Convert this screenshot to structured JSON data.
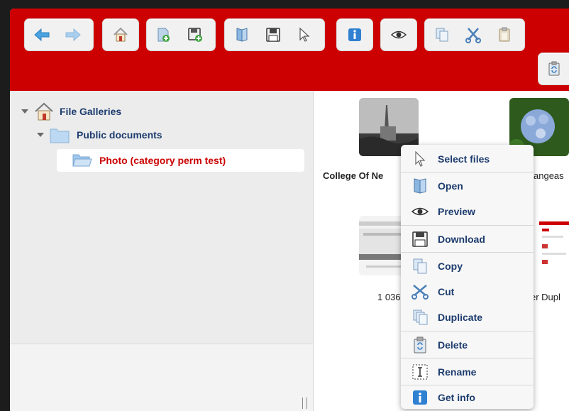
{
  "toolbar": {
    "buttons": [
      "back-icon",
      "forward-icon",
      "home-icon",
      "new-folder-icon",
      "save-new-icon",
      "open-icon",
      "download-icon",
      "select-icon",
      "info-icon",
      "preview-icon",
      "copy-icon",
      "cut-icon",
      "paste-icon",
      "refresh-icon"
    ]
  },
  "tree": {
    "root": "File Galleries",
    "child": "Public documents",
    "selected": "Photo (category perm test)"
  },
  "files": {
    "f1": "College Of Ne",
    "f2": "angeas",
    "f3": "1 036",
    "f4": "er Dupl"
  },
  "menu": {
    "select": "Select files",
    "open": "Open",
    "preview": "Preview",
    "download": "Download",
    "copy": "Copy",
    "cut": "Cut",
    "duplicate": "Duplicate",
    "delete": "Delete",
    "rename": "Rename",
    "info": "Get info"
  },
  "colors": {
    "toolbar": "#cc0000",
    "selected_text": "#cc0000",
    "link": "#1d3c6e"
  }
}
